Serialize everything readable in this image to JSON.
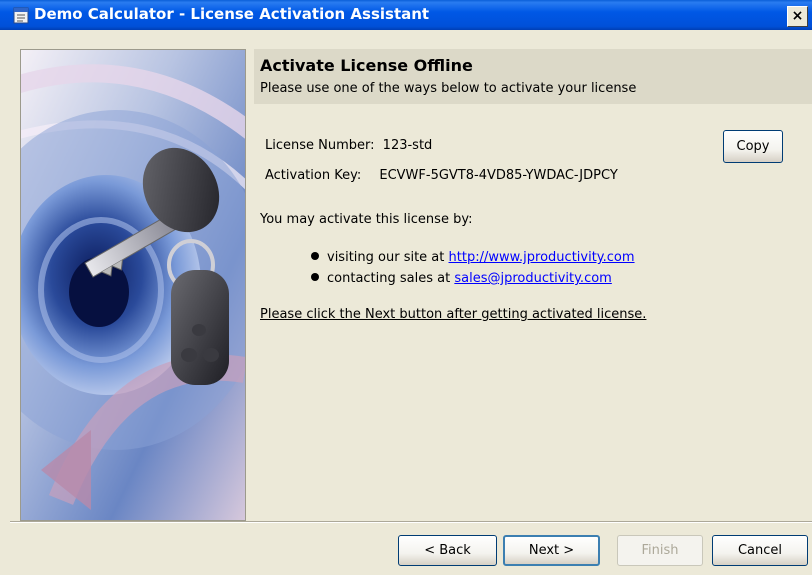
{
  "window": {
    "title": "Demo Calculator - License Activation Assistant",
    "close_label": "×"
  },
  "header": {
    "title": "Activate License Offline",
    "subtitle": "Please use one of the ways below to activate your license"
  },
  "license": {
    "number_label": "License Number:",
    "number_value": "123-std",
    "key_label": "Activation Key:",
    "key_value": "ECVWF-5GVT8-4VD85-YWDAC-JDPCY",
    "copy_label": "Copy"
  },
  "activation": {
    "intro": "You may activate this license by:",
    "options": [
      {
        "prefix": "visiting our site at",
        "link": "http://www.jproductivity.com"
      },
      {
        "prefix": "contacting sales at",
        "link": "sales@jproductivity.com"
      }
    ],
    "note": "Please click the Next button after getting activated license."
  },
  "buttons": {
    "back": "< Back",
    "next": "Next >",
    "finish": "Finish",
    "cancel": "Cancel"
  },
  "colors": {
    "titlebar": "#0058e6",
    "dialog_bg": "#ece9d8",
    "link": "#0000ff"
  },
  "icons": [
    "dialog-app-icon",
    "key-illustration",
    "bullet-icon"
  ]
}
